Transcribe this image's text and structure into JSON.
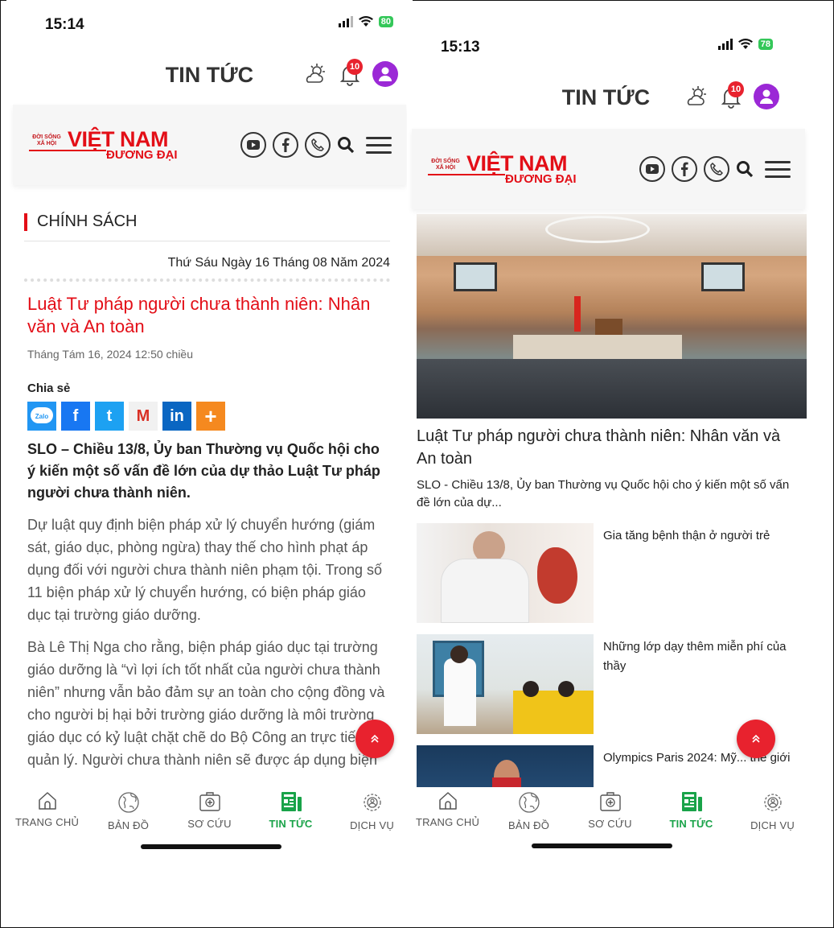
{
  "colors": {
    "accent": "#e30e17",
    "tab_active": "#19a349",
    "badge": "#e8222e",
    "avatar": "#9b28d6",
    "battery": "#34c759"
  },
  "left": {
    "status": {
      "time": "15:14",
      "battery": "80"
    },
    "appbar": {
      "title": "TIN TỨC",
      "notification_count": "10"
    },
    "site": {
      "logo_small": "ĐỜI SỐNG XÃ HỘI",
      "logo_main": "VIỆT NAM",
      "logo_sub": "ĐƯƠNG ĐẠI"
    },
    "article": {
      "section": "CHÍNH SÁCH",
      "date": "Thứ Sáu Ngày 16 Tháng 08 Năm 2024",
      "headline": "Luật Tư pháp người chưa thành niên: Nhân văn và An toàn",
      "meta": "Tháng Tám 16, 2024 12:50 chiều",
      "share_label": "Chia sẻ",
      "share_buttons": [
        "Zalo",
        "f",
        "t",
        "M",
        "in",
        "+"
      ],
      "lead": "SLO – Chiều 13/8, Ủy ban Thường vụ Quốc hội cho ý kiến một số vấn đề lớn của dự thảo Luật Tư pháp người chưa thành niên.",
      "para1": "Dự luật quy định biện pháp xử lý chuyển hướng (giám sát, giáo dục, phòng ngừa) thay thế cho hình phạt áp dụng đối với người chưa thành niên phạm tội. Trong số 11 biện pháp xử lý chuyển hướng, có biện pháp giáo dục tại trường giáo dưỡng.",
      "para2": "Bà Lê Thị Nga cho rằng, biện pháp giáo dục tại trường giáo dưỡng là “vì lợi ích tốt nhất của người chưa thành niên” nhưng vẫn bảo đảm sự an toàn cho cộng đồng và cho người bị hại bởi trường giáo dưỡng là môi trường giáo dục có kỷ luật chặt chẽ do Bộ Công an trực tiếp quản lý. Người chưa thành niên sẽ được áp dụng biện"
    }
  },
  "right": {
    "status": {
      "time": "15:13",
      "battery": "78"
    },
    "appbar": {
      "title": "TIN TỨC",
      "notification_count": "10"
    },
    "site": {
      "logo_small": "ĐỜI SỐNG XÃ HỘI",
      "logo_main": "VIỆT NAM",
      "logo_sub": "ĐƯƠNG ĐẠI"
    },
    "feature": {
      "title": "Luật Tư pháp người chưa thành niên: Nhân văn và An toàn",
      "summary": "SLO - Chiều 13/8, Ủy ban Thường vụ Quốc hội cho ý kiến một số vấn đề lớn của dự..."
    },
    "items": [
      {
        "title": "Gia tăng bệnh thận ở người trẻ"
      },
      {
        "title": "Những lớp dạy thêm miễn phí của thầy"
      },
      {
        "title": "Olympics Paris 2024: Mỹ... thế giới"
      }
    ]
  },
  "tabs": [
    "TRANG CHỦ",
    "BẢN ĐỒ",
    "SƠ CỨU",
    "TIN TỨC",
    "DỊCH VỤ"
  ],
  "active_tab": "TIN TỨC",
  "icons": [
    "signal-icon",
    "wifi-icon",
    "weather-icon",
    "bell-icon",
    "user-icon",
    "youtube-icon",
    "facebook-icon",
    "phone-icon",
    "search-icon",
    "menu-icon",
    "scroll-top-icon",
    "home-icon",
    "globe-icon",
    "first-aid-icon",
    "news-icon",
    "services-icon"
  ]
}
